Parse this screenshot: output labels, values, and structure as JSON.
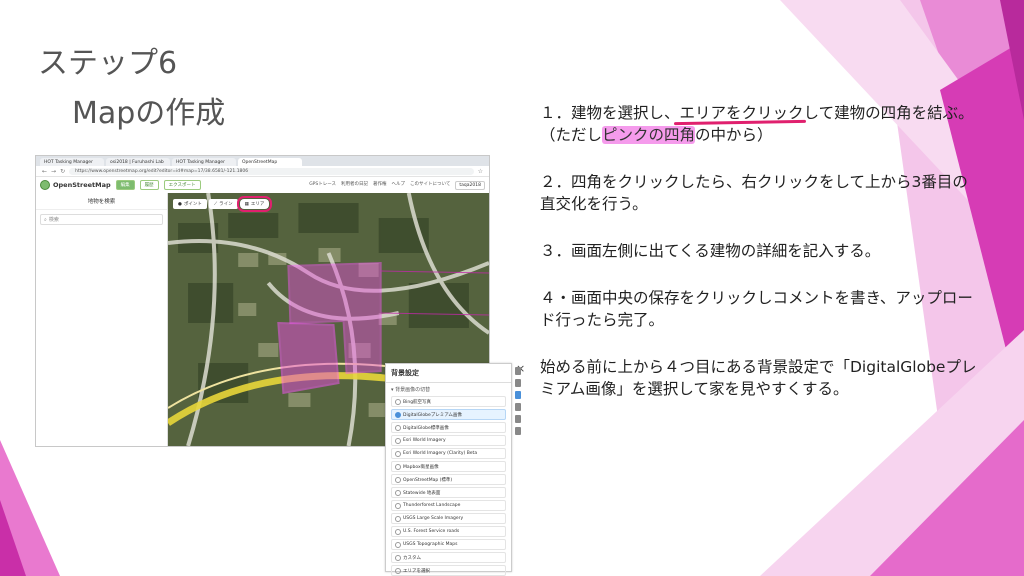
{
  "slide": {
    "title": "ステップ6",
    "subtitle": "Mapの作成",
    "colors": {
      "accent": "#e0206e",
      "highlight": "#ec48dc",
      "decor": "#d63cb5"
    }
  },
  "instructions": {
    "step1_a": "１．建物を選択し、",
    "step1_underline": "エリアをクリック",
    "step1_b": "して建物の四角を結ぶ。（ただし",
    "step1_highlight": "ピンクの四角",
    "step1_c": "の中から）",
    "step2": "２．四角をクリックしたら、右クリックをして上から3番目の直交化を行う。",
    "step3": "３．画面左側に出てくる建物の詳細を記入する。",
    "step4": "４・画面中央の保存をクリックしコメントを書き、アップロード行ったら完了。",
    "note": "始める前に上から４つ目にある背景設定で「DigitalGlobeプレミアム画像」を選択して家を見やすくする。"
  },
  "browser": {
    "tabs": [
      "HOT Tasking Manager",
      "osi2018 | Furuhashi Lab",
      "HOT Tasking Manager",
      "OpenStreetMap"
    ],
    "url": "https://www.openstreetmap.org/edit?editor=id#map=17/38.6581/-121.1806",
    "osm": {
      "logo": "OpenStreetMap",
      "edit_button": "編集",
      "history_button": "履歴",
      "export_button": "エクスポート",
      "menu": [
        "GPSトレース",
        "利用者の日記",
        "著作権",
        "ヘルプ",
        "このサイトについて"
      ],
      "user": "taqa2018"
    },
    "sidebar": {
      "title": "地物を検索",
      "search_placeholder": "検索"
    },
    "toolbar": {
      "point": "ポイント",
      "line": "ライン",
      "area": "エリア"
    }
  },
  "background_panel": {
    "title": "背景設定",
    "section": "背景画像の切替",
    "items": [
      "Bing航空写真",
      "DigitalGlobeプレミアム画像",
      "DigitalGlobe標準画像",
      "Esri World Imagery",
      "Esri World Imagery (Clarity) Beta",
      "Mapbox衛星画像",
      "OpenStreetMap (標準)",
      "Statewide 地表面",
      "Thunderforest Landscape",
      "USGS Large Scale Imagery",
      "U.S. Forest Service roads",
      "USGS Topographic Maps",
      "カスタム",
      "エリアを選択"
    ],
    "selected_index": 1
  }
}
